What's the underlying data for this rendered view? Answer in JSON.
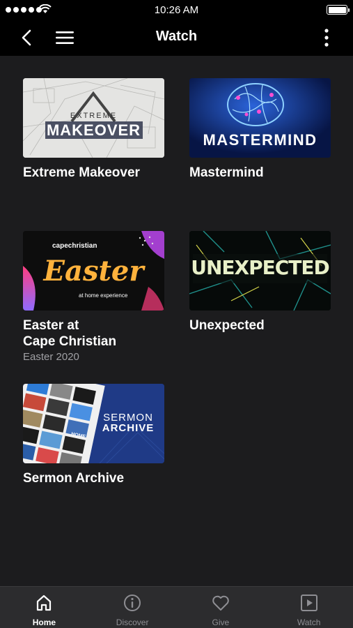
{
  "status_bar": {
    "time": "10:26 AM"
  },
  "nav": {
    "title": "Watch"
  },
  "series": [
    {
      "title": "Extreme Makeover",
      "subtitle": "",
      "art": {
        "line1": "EXTREME",
        "line2": "MAKEOVER"
      }
    },
    {
      "title": "Mastermind",
      "subtitle": "",
      "art": {
        "line1": "MASTERMIND"
      }
    },
    {
      "title": "Easter at\nCape Christian",
      "subtitle": "Easter 2020",
      "art": {
        "brand": "capechristian",
        "word": "Easter",
        "tagline": "at home experience"
      }
    },
    {
      "title": "Unexpected",
      "subtitle": "",
      "art": {
        "word": "UNEXPECTED"
      }
    },
    {
      "title": "Sermon Archive",
      "subtitle": "",
      "art": {
        "line1": "SERMON",
        "line2": "ARCHIVE",
        "tile": "HOME"
      }
    }
  ],
  "tabs": [
    {
      "label": "Home",
      "icon": "home-icon",
      "active": true
    },
    {
      "label": "Discover",
      "icon": "info-icon",
      "active": false
    },
    {
      "label": "Give",
      "icon": "heart-icon",
      "active": false
    },
    {
      "label": "Watch",
      "icon": "play-icon",
      "active": false
    }
  ],
  "colors": {
    "background": "#1c1c1e",
    "bar": "#000000",
    "tab_bar": "#2c2c2e",
    "inactive": "#8e8e93"
  }
}
